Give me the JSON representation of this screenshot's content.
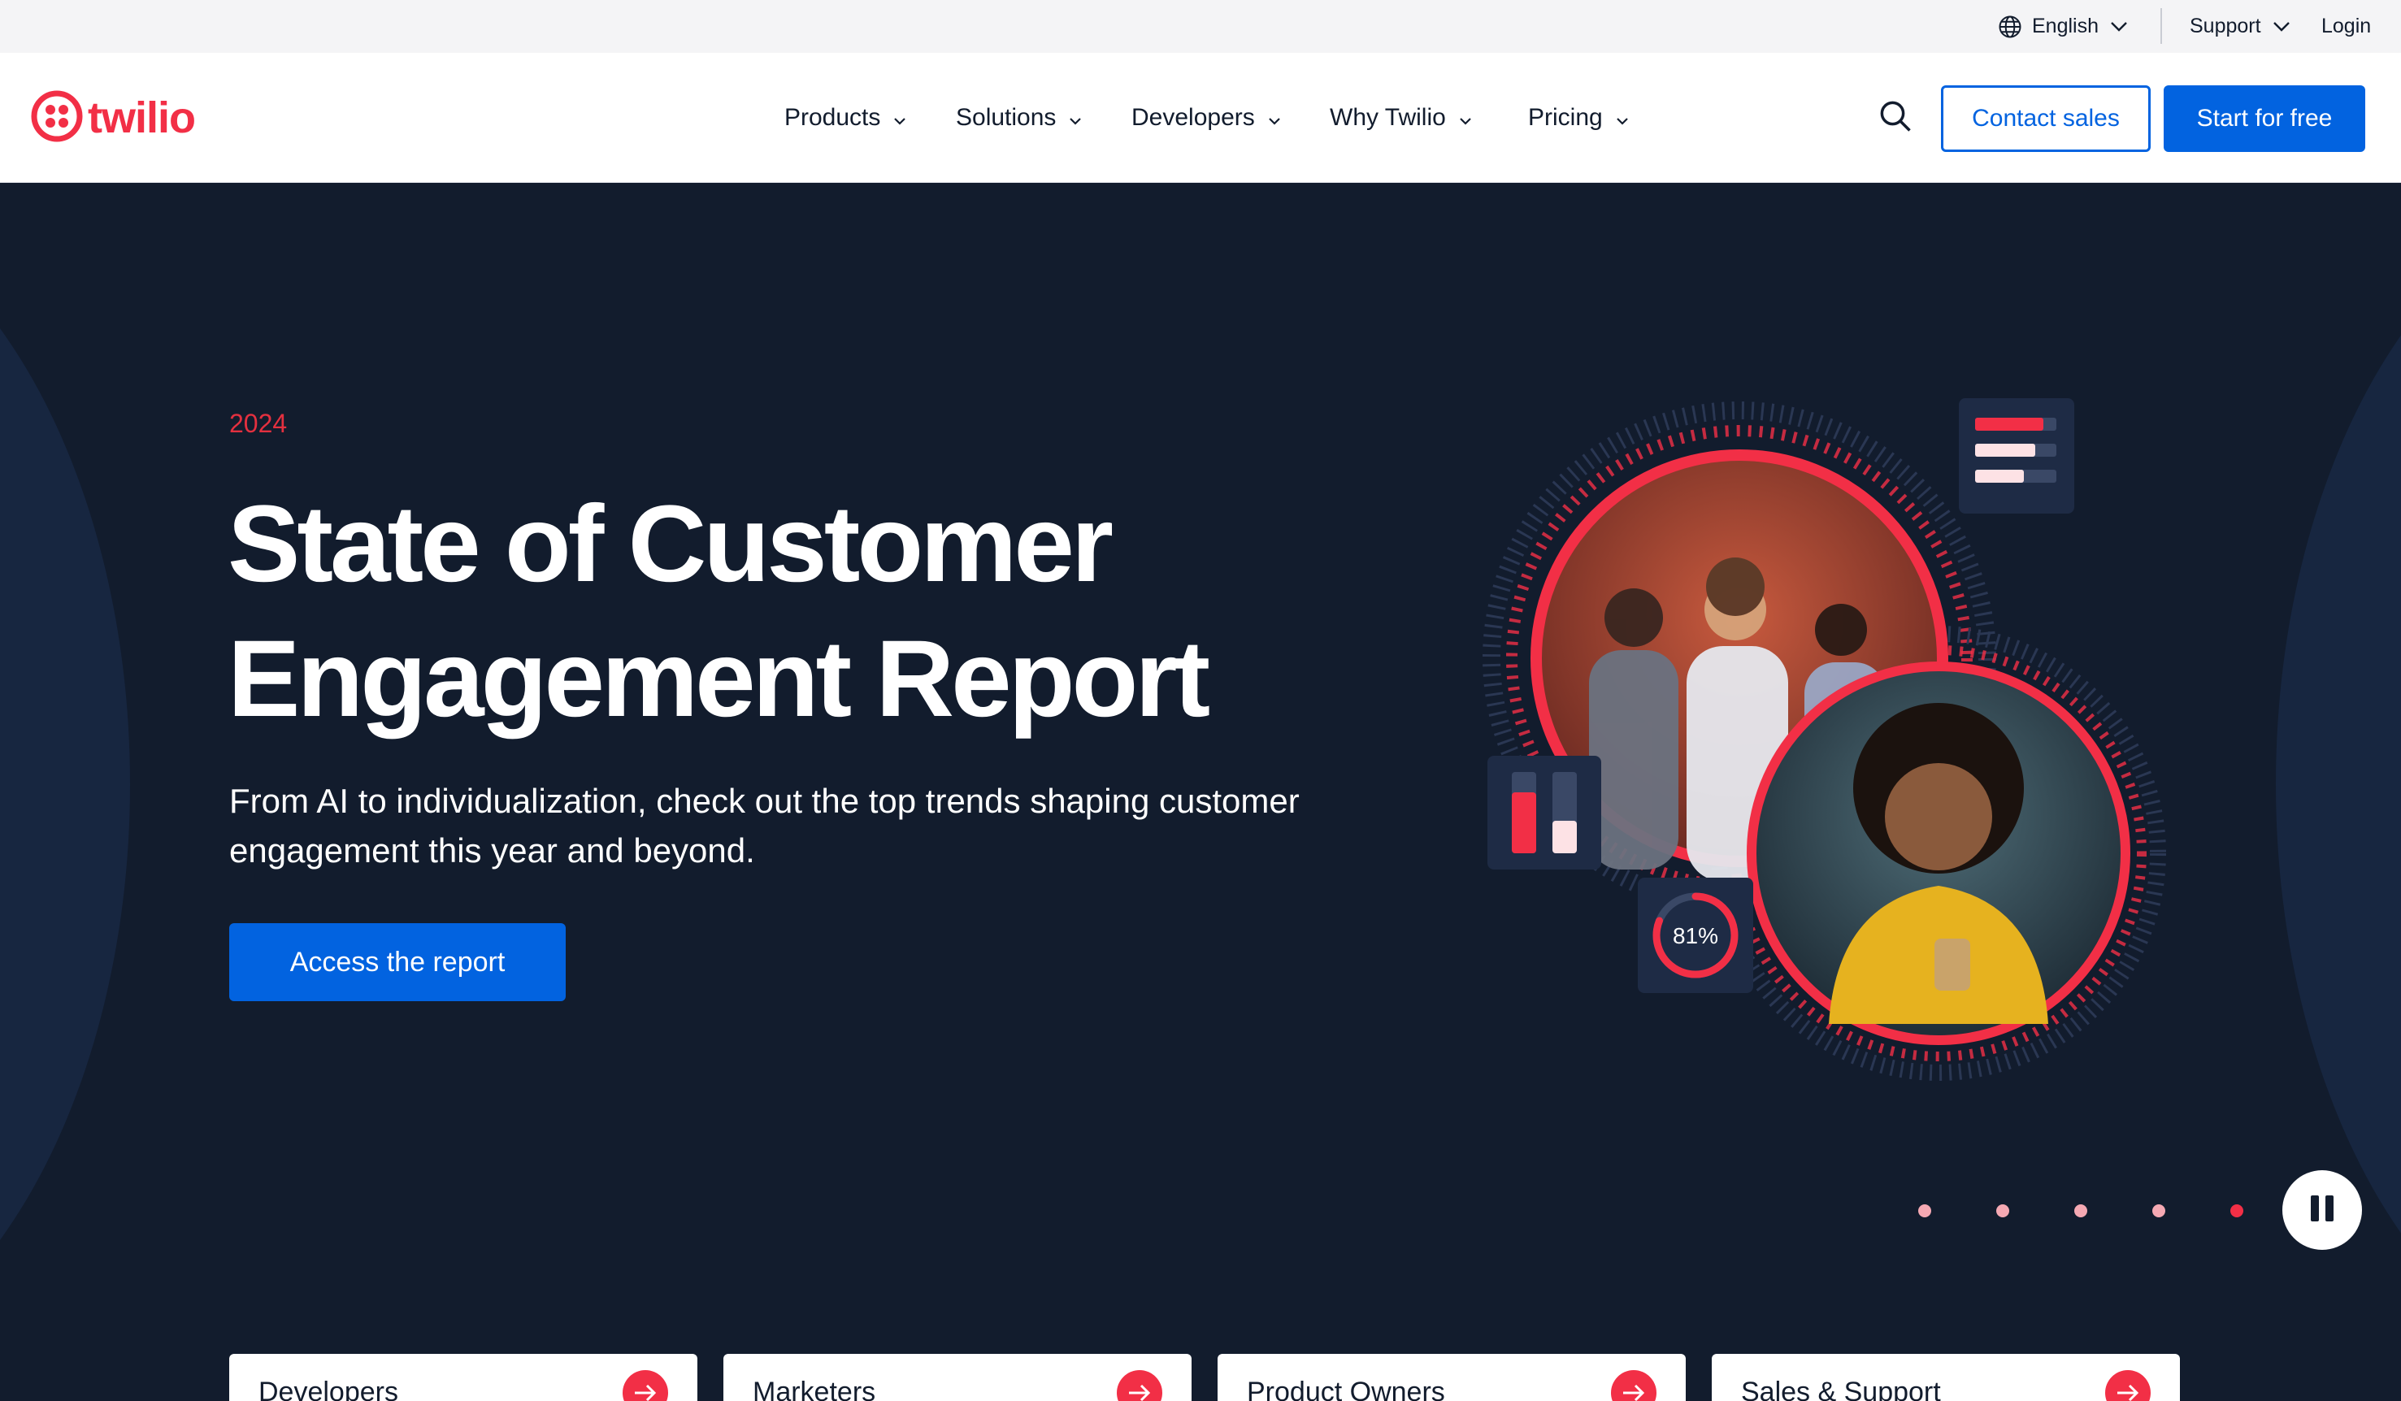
{
  "utility_bar": {
    "language_label": "English",
    "support_label": "Support",
    "login_label": "Login"
  },
  "header": {
    "logo_text": "twilio",
    "nav": [
      {
        "label": "Products"
      },
      {
        "label": "Solutions"
      },
      {
        "label": "Developers"
      },
      {
        "label": "Why Twilio"
      },
      {
        "label": "Pricing"
      }
    ],
    "contact_sales_label": "Contact sales",
    "start_free_label": "Start for free"
  },
  "hero": {
    "eyebrow": "2024",
    "title_line1": "State of Customer",
    "title_line2": "Engagement Report",
    "subtitle": "From AI to individualization, check out the top trends shaping customer engagement this year and beyond.",
    "cta_label": "Access the report",
    "stat_badge": "81%",
    "stat_progress": 0.81
  },
  "carousel": {
    "slide_count": 5,
    "active_index": 4
  },
  "audience_cards": [
    {
      "label": "Developers"
    },
    {
      "label": "Marketers"
    },
    {
      "label": "Product Owners"
    },
    {
      "label": "Sales & Support"
    }
  ],
  "colors": {
    "brand_red": "#f22f46",
    "brand_blue": "#0263e0",
    "hero_bg": "#121c2d"
  },
  "icons": [
    "globe-icon",
    "chevron-down-icon",
    "search-icon",
    "pause-icon",
    "arrow-right-icon"
  ]
}
